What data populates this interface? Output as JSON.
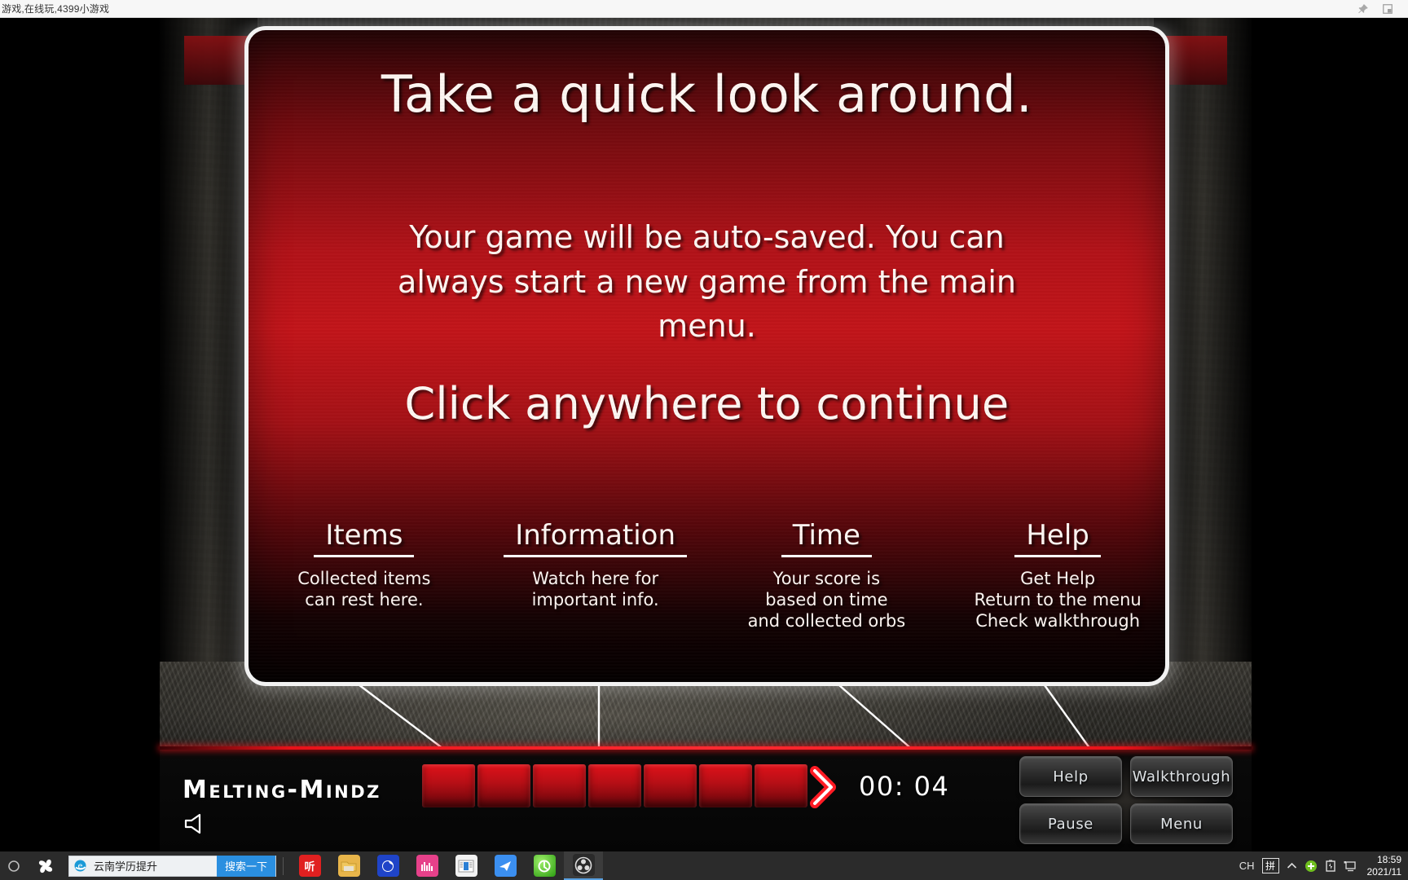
{
  "browser": {
    "title": "游戏,在线玩,4399小游戏",
    "pin_icon": "pin-icon",
    "restore_icon": "restore-window-icon"
  },
  "dialog": {
    "title": "Take a quick look around.",
    "body": "Your game will be auto-saved. You can always start a new game from the main menu.",
    "cta": "Click anywhere to continue",
    "columns": [
      {
        "title": "Items",
        "desc": "Collected items\ncan rest here."
      },
      {
        "title": "Information",
        "desc": "Watch here for\nimportant info."
      },
      {
        "title": "Time",
        "desc": "Your score is\nbased on time\nand collected orbs"
      },
      {
        "title": "Help",
        "desc": "Get Help\nReturn to the menu\nCheck walkthrough"
      }
    ]
  },
  "hud": {
    "brand": "Melting-Mindz",
    "sound_icon": "speaker-icon",
    "arrow_icon": "chevron-right-icon",
    "timer": "00: 04",
    "slot_count": 7,
    "buttons": [
      {
        "label": "Help"
      },
      {
        "label": "Walkthrough"
      },
      {
        "label": "Pause"
      },
      {
        "label": "Menu"
      }
    ]
  },
  "taskbar": {
    "start_icon": "start-orb-icon",
    "logo_icon": "360-browser-icon",
    "search": {
      "value": "云南学历提升",
      "button": "搜索一下",
      "engine_icon": "ie-icon"
    },
    "apps": [
      {
        "name": "tb-app-kingsoft",
        "glyph": "听",
        "color": "#e02020"
      },
      {
        "name": "tb-app-explorer",
        "glyph": "",
        "color": "#e8b54a"
      },
      {
        "name": "tb-app-browser",
        "glyph": "",
        "color": "#1f44c8"
      },
      {
        "name": "tb-app-music",
        "glyph": "",
        "color": "#e6418a"
      },
      {
        "name": "tb-app-reader",
        "glyph": "",
        "color": "#f2f2f2"
      },
      {
        "name": "tb-app-messenger",
        "glyph": "",
        "color": "#3b8ff0"
      },
      {
        "name": "tb-app-greenbrowser",
        "glyph": "",
        "color": "#4ec820"
      },
      {
        "name": "tb-app-obs",
        "glyph": "",
        "color": "#2a2a2a"
      }
    ],
    "tray": {
      "lang": "CH",
      "ime": "拼",
      "chevron": "chevron-up-icon",
      "shield_icon": "security-icon",
      "battery_icon": "battery-icon",
      "network_icon": "network-icon",
      "time": "18:59",
      "date": "2021/11"
    }
  },
  "colors": {
    "dialog_red": "#c21419",
    "accent_red": "#e81219",
    "dialog_border": "#f2f2f2",
    "taskbar_bg": "#2b2b2b",
    "search_blue": "#2a8fe0"
  }
}
